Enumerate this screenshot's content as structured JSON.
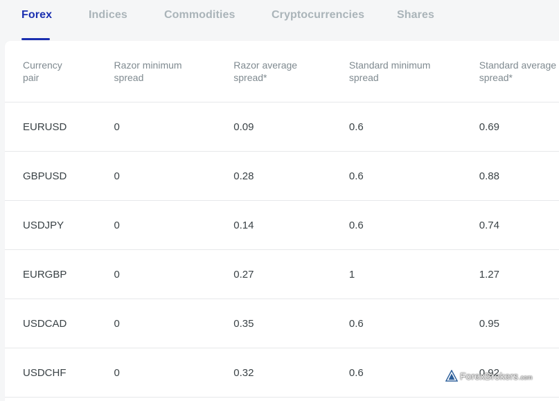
{
  "tabs": [
    {
      "label": "Forex",
      "active": true
    },
    {
      "label": "Indices",
      "active": false
    },
    {
      "label": "Commodities",
      "active": false
    },
    {
      "label": "Cryptocurrencies",
      "active": false
    },
    {
      "label": "Shares",
      "active": false
    }
  ],
  "table": {
    "headers": [
      [
        "Currency",
        "pair"
      ],
      [
        "Razor minimum",
        "spread"
      ],
      [
        "Razor average",
        "spread*"
      ],
      [
        "Standard minimum",
        "spread"
      ],
      [
        "Standard average",
        "spread*"
      ]
    ],
    "rows": [
      [
        "EURUSD",
        "0",
        "0.09",
        "0.6",
        "0.69"
      ],
      [
        "GBPUSD",
        "0",
        "0.28",
        "0.6",
        "0.88"
      ],
      [
        "USDJPY",
        "0",
        "0.14",
        "0.6",
        "0.74"
      ],
      [
        "EURGBP",
        "0",
        "0.27",
        "1",
        "1.27"
      ],
      [
        "USDCAD",
        "0",
        "0.35",
        "0.6",
        "0.95"
      ],
      [
        "USDCHF",
        "0",
        "0.32",
        "0.6",
        "0.92"
      ]
    ]
  },
  "watermark": {
    "brand": "ForexBrokers",
    "suffix": ".com"
  },
  "colors": {
    "accent": "#1a2fb0",
    "inactive_tab": "#aab4b9",
    "header_text": "#7f8a90",
    "cell_text": "#3a4246",
    "divider": "#e6e8ea",
    "page_background": "#f5f6f7"
  }
}
